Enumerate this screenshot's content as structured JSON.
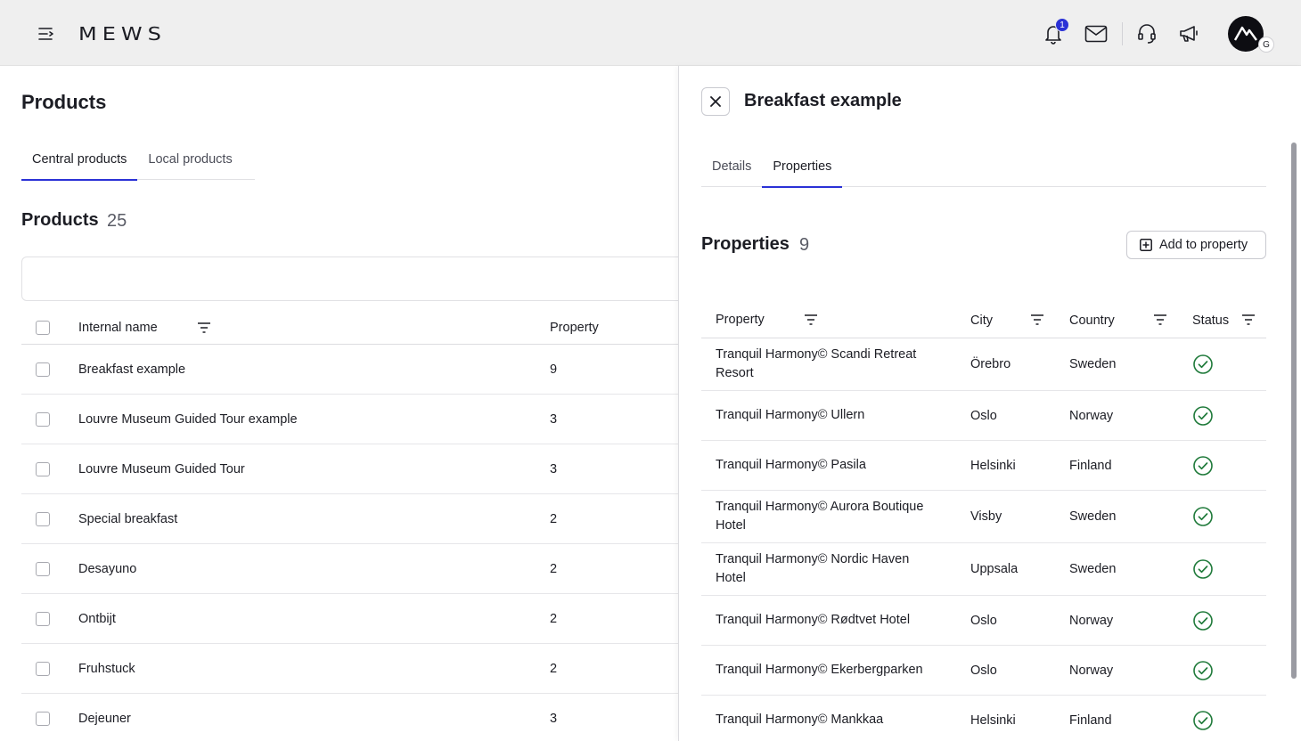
{
  "topbar": {
    "logo": "MEWS",
    "notification_count": "1",
    "avatar_initial": "G",
    "icons": [
      "menu-icon",
      "bell-icon",
      "mail-icon",
      "headset-icon",
      "megaphone-icon"
    ]
  },
  "left": {
    "page_title": "Products",
    "tabs": [
      {
        "label": "Central products",
        "active": true
      },
      {
        "label": "Local products",
        "active": false
      }
    ],
    "products_heading": "Products",
    "products_count": "25",
    "table": {
      "headers": {
        "name": "Internal name",
        "property": "Property"
      },
      "rows": [
        {
          "name": "Breakfast example",
          "property": "9"
        },
        {
          "name": "Louvre Museum Guided Tour example",
          "property": "3"
        },
        {
          "name": "Louvre Museum Guided Tour",
          "property": "3"
        },
        {
          "name": "Special breakfast",
          "property": "2"
        },
        {
          "name": "Desayuno",
          "property": "2"
        },
        {
          "name": "Ontbijt",
          "property": "2"
        },
        {
          "name": "Fruhstuck",
          "property": "2"
        },
        {
          "name": "Dejeuner",
          "property": "3"
        }
      ]
    }
  },
  "panel": {
    "title": "Breakfast example",
    "tabs": [
      {
        "label": "Details",
        "active": false
      },
      {
        "label": "Properties",
        "active": true
      }
    ],
    "properties_heading": "Properties",
    "properties_count": "9",
    "add_button_label": "Add to property",
    "table": {
      "headers": {
        "property": "Property",
        "city": "City",
        "country": "Country",
        "status": "Status"
      },
      "rows": [
        {
          "property": "Tranquil Harmony© Scandi Retreat Resort",
          "city": "Örebro",
          "country": "Sweden",
          "status": "active",
          "tall": true
        },
        {
          "property": "Tranquil Harmony© Ullern",
          "city": "Oslo",
          "country": "Norway",
          "status": "active",
          "tall": false
        },
        {
          "property": "Tranquil Harmony© Pasila",
          "city": "Helsinki",
          "country": "Finland",
          "status": "active",
          "tall": false
        },
        {
          "property": "Tranquil Harmony© Aurora Boutique Hotel",
          "city": "Visby",
          "country": "Sweden",
          "status": "active",
          "tall": true
        },
        {
          "property": "Tranquil Harmony© Nordic Haven Hotel",
          "city": "Uppsala",
          "country": "Sweden",
          "status": "active",
          "tall": true
        },
        {
          "property": "Tranquil Harmony© Rødtvet Hotel",
          "city": "Oslo",
          "country": "Norway",
          "status": "active",
          "tall": false
        },
        {
          "property": "Tranquil Harmony© Ekerbergparken",
          "city": "Oslo",
          "country": "Norway",
          "status": "active",
          "tall": false
        },
        {
          "property": "Tranquil Harmony© Mankkaa",
          "city": "Helsinki",
          "country": "Finland",
          "status": "active",
          "tall": false
        }
      ]
    }
  },
  "colors": {
    "accent": "#2a31d6",
    "status_ok": "#1f7a3a",
    "topbar_bg": "#efefef"
  }
}
